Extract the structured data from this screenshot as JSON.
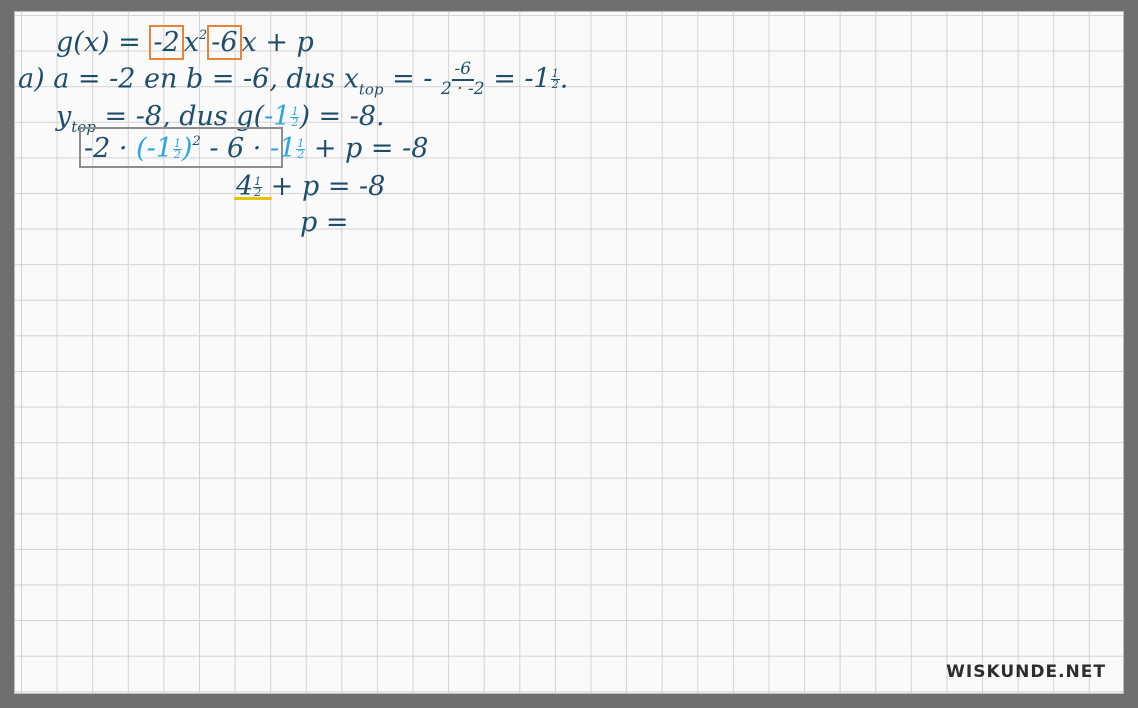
{
  "line1": {
    "lhs": "g(x) = ",
    "coef_a": "-2",
    "x2": "x",
    "exp2": "2",
    "coef_b": "-6",
    "rest": "x + p"
  },
  "line2": {
    "label": "a)",
    "text": "a = -2 en b = -6, dus x",
    "sub": "top",
    "eq": " = -",
    "frac_num": "-6",
    "frac_den": "2 · -2",
    "result": " = -1",
    "res_num": "1",
    "res_den": "2",
    "end": "."
  },
  "line3": {
    "y": "y",
    "sub": "top",
    "text": " = -8, dus  g(",
    "arg": "-1",
    "arg_num": "1",
    "arg_den": "2",
    "close": ") = -8."
  },
  "line4": {
    "a": "-2 · ",
    "paren_open": "(-1",
    "pn": "1",
    "pd": "2",
    "paren_close": ")",
    "exp": "2",
    "mid": " - 6 · ",
    "neg": "-1",
    "nn": "1",
    "nd": "2",
    "rest": " + p = -8"
  },
  "line5": {
    "val": "4",
    "vn": "1",
    "vd": "2",
    "rest": " + p = -8"
  },
  "line6": {
    "text": "p ="
  },
  "logo": "WISKUNDE.NET",
  "colors": {
    "ink": "#1f4e6b",
    "highlight_blue": "#2aa6e0",
    "box_orange": "#e8833a",
    "box_gray": "#8d8d8d",
    "underline_yellow": "#e7c400"
  }
}
